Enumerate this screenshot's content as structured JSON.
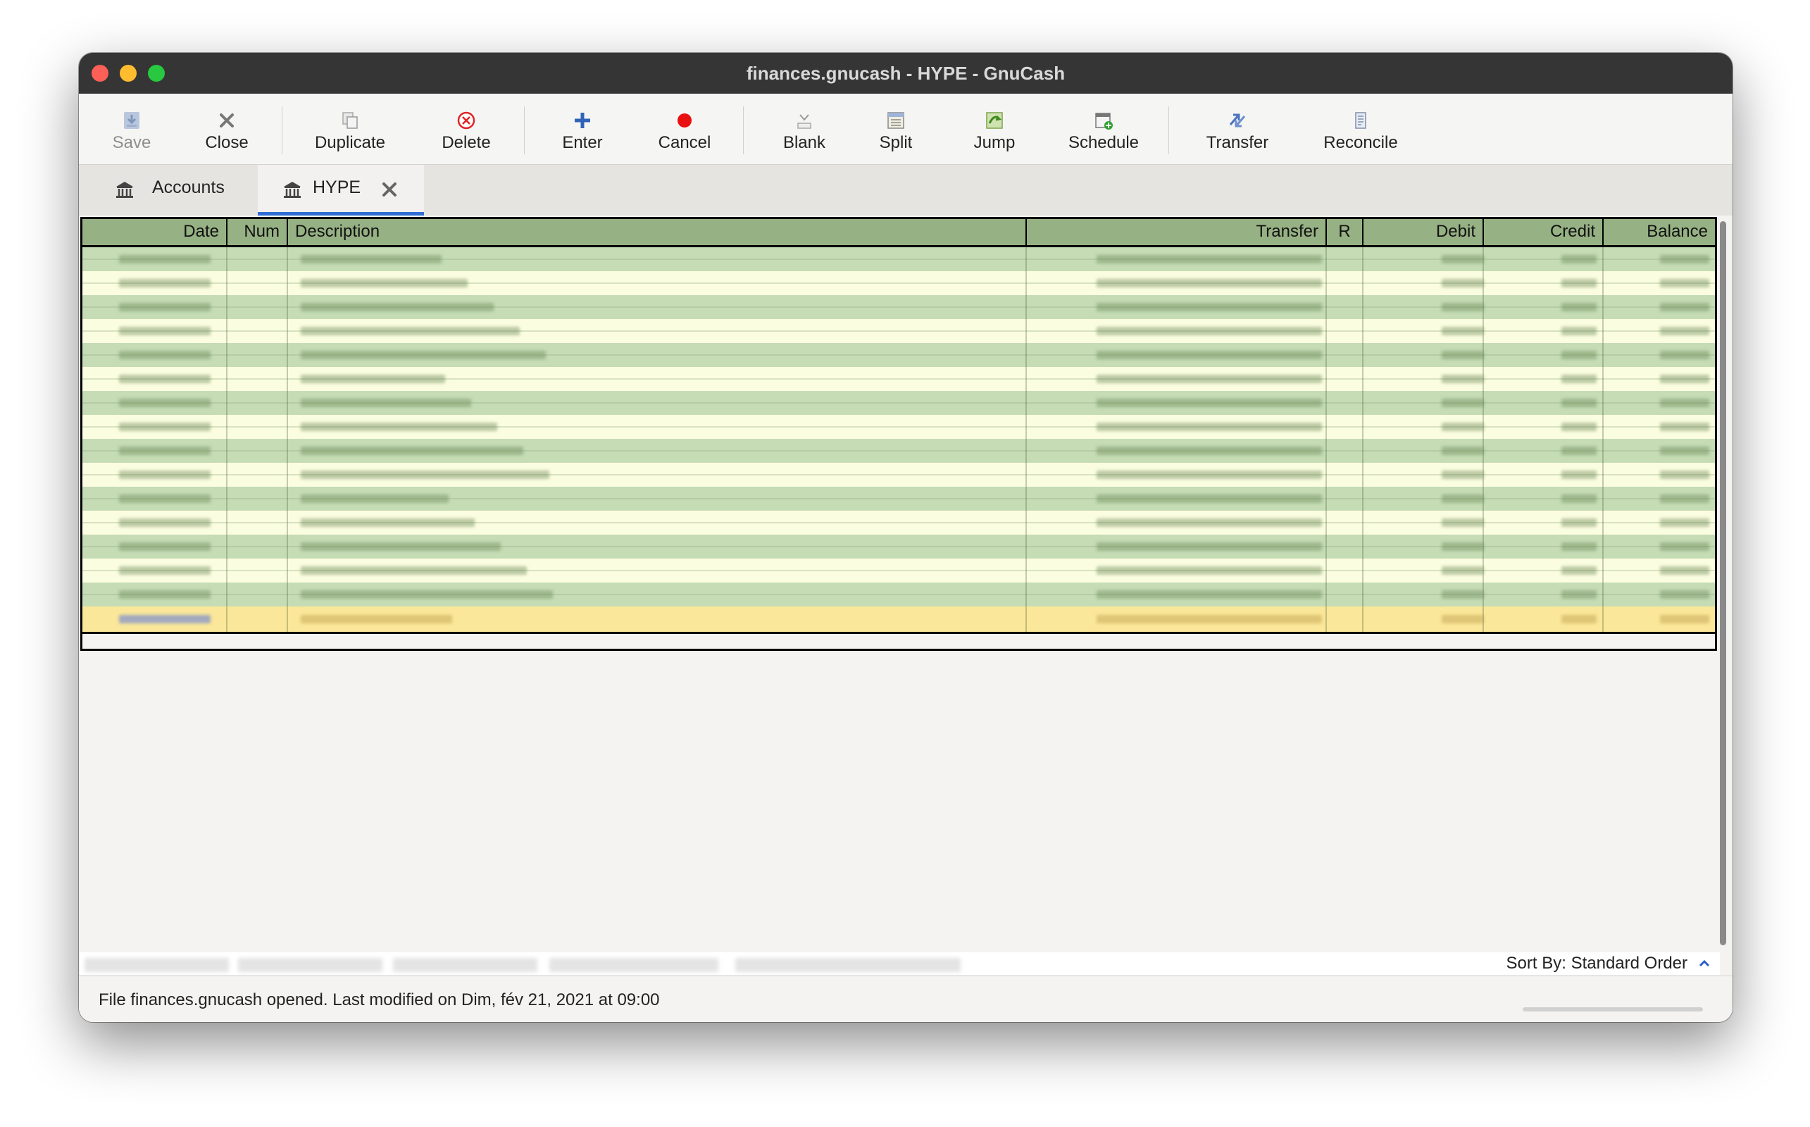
{
  "window": {
    "title": "finances.gnucash - HYPE - GnuCash"
  },
  "toolbar": {
    "save": "Save",
    "close": "Close",
    "duplicate": "Duplicate",
    "delete": "Delete",
    "enter": "Enter",
    "cancel": "Cancel",
    "blank": "Blank",
    "split": "Split",
    "jump": "Jump",
    "schedule": "Schedule",
    "transfer": "Transfer",
    "reconcile": "Reconcile"
  },
  "tabs": [
    {
      "label": "Accounts",
      "icon": "bank-icon"
    },
    {
      "label": "HYPE",
      "icon": "bank-icon"
    }
  ],
  "register": {
    "columns": {
      "date": "Date",
      "num": "Num",
      "description": "Description",
      "transfer": "Transfer",
      "r": "R",
      "debit": "Debit",
      "credit": "Credit",
      "balance": "Balance"
    },
    "colors": {
      "header": "#96b183",
      "row_green": "#c5dcb5",
      "row_cream": "#fbfde0",
      "row_selected": "#fbe799"
    }
  },
  "sort": {
    "label": "Sort By:",
    "value": "Standard Order"
  },
  "status": {
    "message": "File finances.gnucash opened. Last modified on Dim, fév 21, 2021 at 09:00"
  }
}
